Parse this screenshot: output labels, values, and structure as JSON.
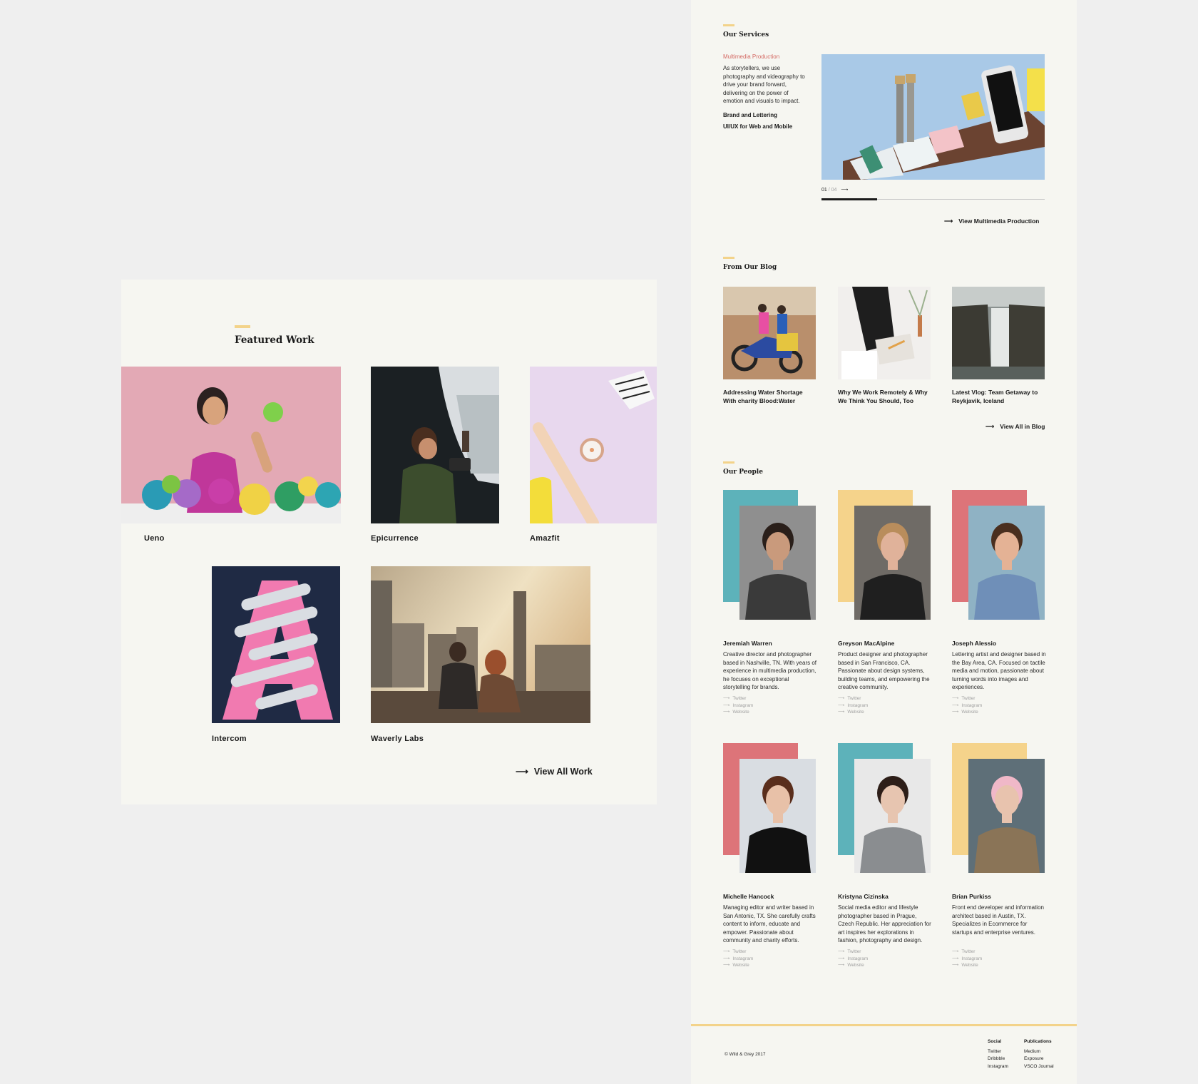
{
  "featured": {
    "title": "Featured Work",
    "items": [
      {
        "label": "Ueno"
      },
      {
        "label": "Epicurrence"
      },
      {
        "label": "Amazfit"
      },
      {
        "label": "Intercom"
      },
      {
        "label": "Waverly Labs"
      }
    ],
    "view_all": "View All Work",
    "arrow": "⟶"
  },
  "services": {
    "title": "Our Services",
    "active": "Multimedia Production",
    "description": "As storytellers, we use photography and videography to drive your brand forward, delivering on the power of emotion and visuals to impact.",
    "items": [
      "Brand and Lettering",
      "UI/UX for Web and Mobile"
    ],
    "slide_current": "01",
    "slide_total": "/ 04",
    "slide_arrow": "⟶",
    "progress": 0.25,
    "view_link": "View Multimedia Production"
  },
  "blog": {
    "title": "From Our Blog",
    "posts": [
      {
        "title": "Addressing Water Shortage With charity Blood:Water"
      },
      {
        "title": "Why We Work Remotely & Why We Think You Should, Too"
      },
      {
        "title": "Latest Vlog: Team Getaway to Reykjavik, Iceland"
      }
    ],
    "view_all": "View All in Blog"
  },
  "people": {
    "title": "Our People",
    "links": [
      "Twitter",
      "Instagram",
      "Website"
    ],
    "link_arrow": "⟶",
    "members": [
      {
        "name": "Jeremiah Warren",
        "bio": "Creative director and photographer based in Nashville, TN. With years of experience in multimedia production, he focuses on exceptional storytelling for brands.",
        "color": "#5db2ba"
      },
      {
        "name": "Greyson MacAlpine",
        "bio": "Product designer and photographer based in San Francisco, CA. Passionate about design systems, building teams, and empowering the creative community.",
        "color": "#f5d38b"
      },
      {
        "name": "Joseph Alessio",
        "bio": "Lettering artist and designer based in the Bay Area, CA. Focused on tactile media and motion, passionate about turning words into images and experiences.",
        "color": "#dd7479"
      },
      {
        "name": "Michelle Hancock",
        "bio": "Managing editor and writer based in San Antonic, TX. She  carefully crafts content to inform, educate and empower. Passionate about community and charity efforts.",
        "color": "#dd7479"
      },
      {
        "name": "Kristyna Cizinska",
        "bio": "Social media editor and lifestyle photographer based in Prague, Czech Republic. Her appreciation for art inspires her explorations in fashion, photography and design.",
        "color": "#5db2ba"
      },
      {
        "name": "Brian Purkiss",
        "bio": "Front end developer and information architect based in Austin, TX. Specializes in Ecommerce for startups and enterprise ventures.",
        "color": "#f5d38b"
      }
    ]
  },
  "footer": {
    "copyright": "© Wild & Grey 2017",
    "social": {
      "heading": "Social",
      "items": [
        "Twitter",
        "Dribbble",
        "Instagram"
      ]
    },
    "publications": {
      "heading": "Publications",
      "items": [
        "Medium",
        "Exposure",
        "VSCO Journal"
      ]
    }
  },
  "colors": {
    "accent": "#f3d38a",
    "active_service": "#d46a64",
    "panel": "#f6f6f1",
    "background": "#efefef"
  }
}
